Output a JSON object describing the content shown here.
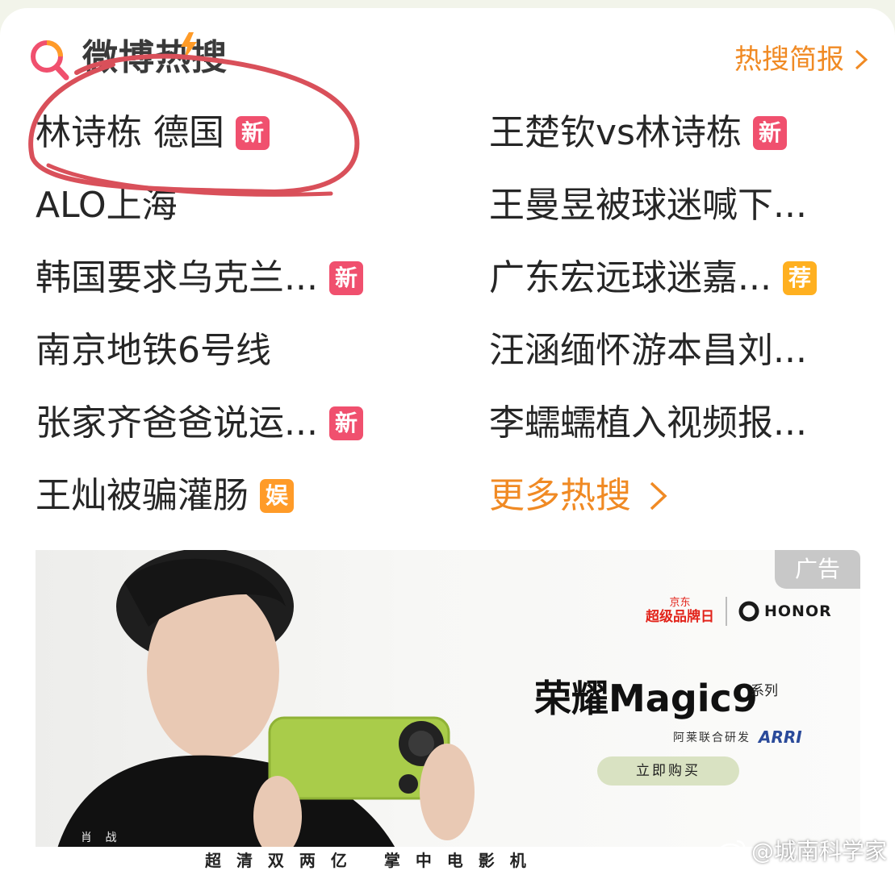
{
  "header": {
    "logo_text": "微博热搜",
    "briefing_link": "热搜简报"
  },
  "hot_search": {
    "left": [
      {
        "text": "林诗栋 德国",
        "badge": "新"
      },
      {
        "text": "ALO上海",
        "badge": ""
      },
      {
        "text": "韩国要求乌克兰...",
        "badge": "新"
      },
      {
        "text": "南京地铁6号线",
        "badge": ""
      },
      {
        "text": "张家齐爸爸说运...",
        "badge": "新"
      },
      {
        "text": "王灿被骗灌肠",
        "badge": "娱"
      }
    ],
    "right": [
      {
        "text": "王楚钦vs林诗栋",
        "badge": "新"
      },
      {
        "text": "王曼昱被球迷喊下...",
        "badge": ""
      },
      {
        "text": "广东宏远球迷嘉...",
        "badge": "荐"
      },
      {
        "text": "汪涵缅怀游本昌刘...",
        "badge": ""
      },
      {
        "text": "李蠕蠕植入视频报...",
        "badge": ""
      }
    ],
    "more_link": "更多热搜"
  },
  "badge_colors": {
    "新": "#f0506e",
    "荐": "#ffb020",
    "娱": "#ff9b28"
  },
  "annotation": {
    "color": "#d9505a"
  },
  "ad": {
    "label": "广告",
    "jd_top": "京东",
    "jd_main": "超级品牌日",
    "brand": "HONOR",
    "title": "荣耀Magic9",
    "series": "系列",
    "subtitle": "阿莱联合研发",
    "partner": "ARRI",
    "buy_button": "立即购买",
    "person_name": "肖 战",
    "bottom_text_1": "超 清 双 两 亿",
    "bottom_text_2": "掌 中 电 影 机"
  },
  "watermark": "@城南科学家"
}
